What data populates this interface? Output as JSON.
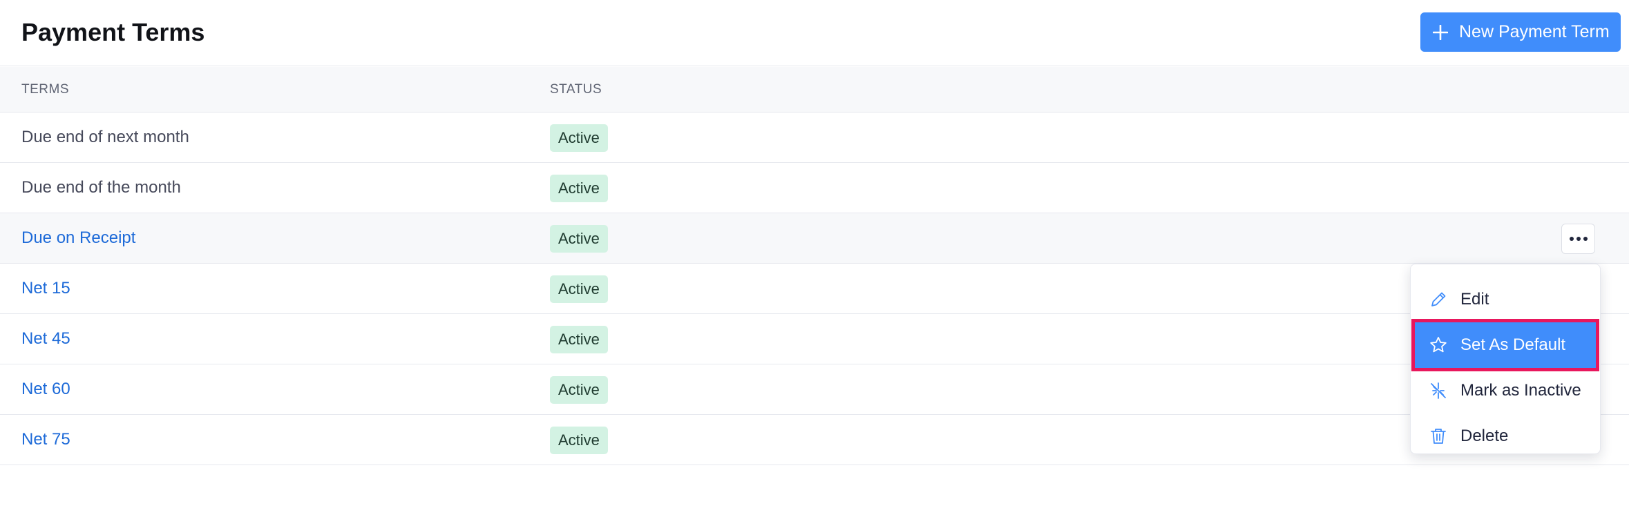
{
  "header": {
    "title": "Payment Terms",
    "new_button_label": "New Payment Term"
  },
  "table": {
    "columns": [
      "TERMS",
      "STATUS"
    ],
    "rows": [
      {
        "term": "Due end of next month",
        "status": "Active"
      },
      {
        "term": "Due end of the month",
        "status": "Active"
      },
      {
        "term": "Due on Receipt",
        "status": "Active"
      },
      {
        "term": "Net 15",
        "status": "Active"
      },
      {
        "term": "Net 45",
        "status": "Active"
      },
      {
        "term": "Net 60",
        "status": "Active"
      },
      {
        "term": "Net 75",
        "status": "Active"
      }
    ]
  },
  "row_actions_menu": {
    "items": [
      {
        "label": "Edit",
        "icon": "pencil-icon"
      },
      {
        "label": "Set As Default",
        "icon": "star-icon",
        "highlighted": true
      },
      {
        "label": "Mark as Inactive",
        "icon": "inactive-icon"
      },
      {
        "label": "Delete",
        "icon": "trash-icon"
      }
    ]
  },
  "colors": {
    "primary": "#408dfb",
    "link": "#1d6ad8",
    "badge_bg": "#d3f2e3",
    "highlight_outline": "#e8175d"
  }
}
